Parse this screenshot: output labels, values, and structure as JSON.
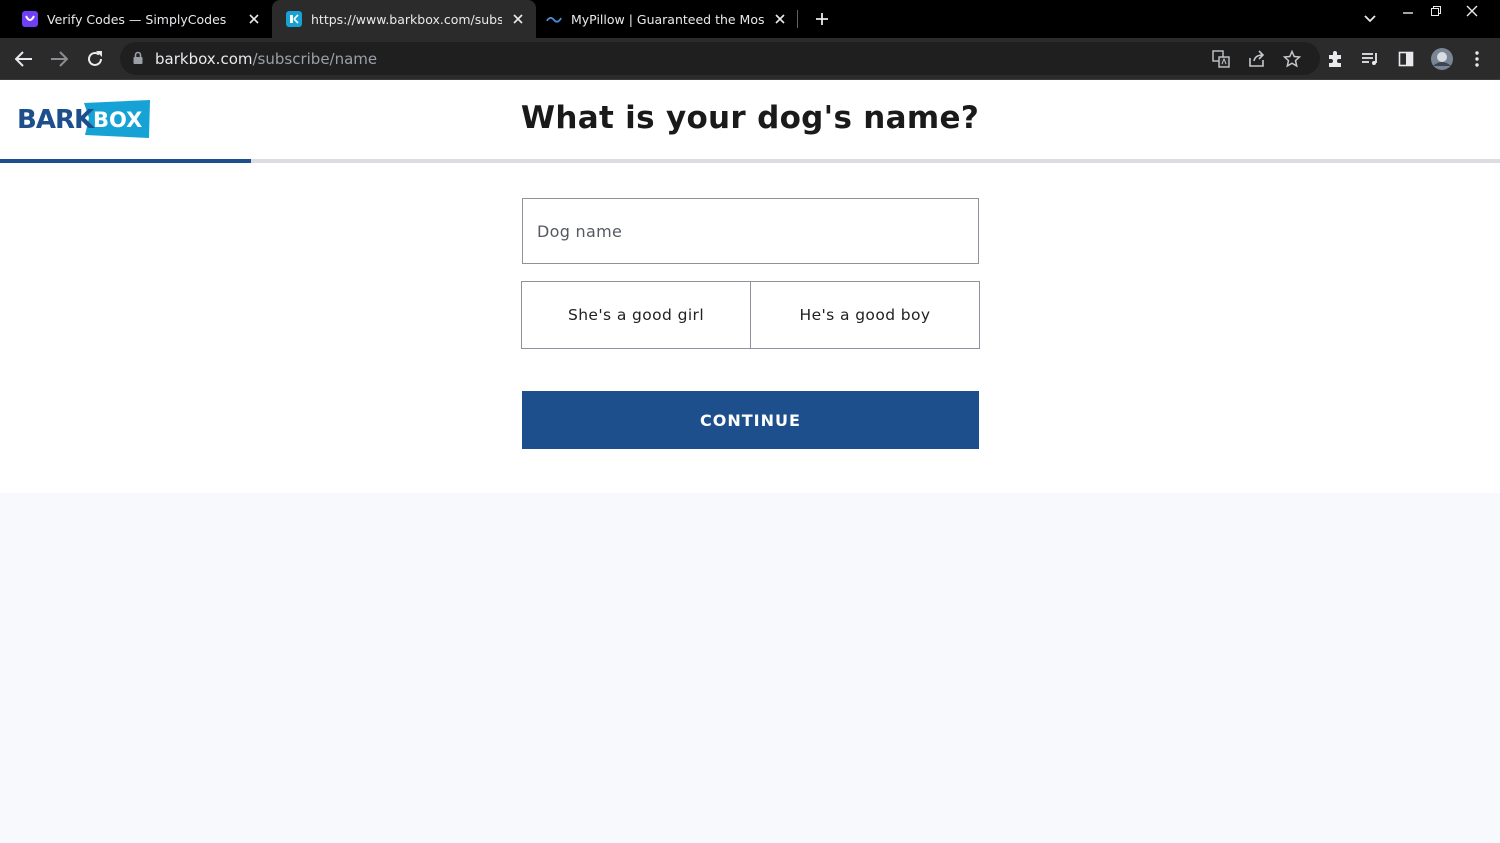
{
  "browser": {
    "tabs": [
      {
        "title": "Verify Codes — SimplyCodes",
        "favicon": "simplycodes-icon",
        "favicon_color": "#6f3ff5",
        "active": false
      },
      {
        "title": "https://www.barkbox.com/subscribe",
        "favicon": "barkbox-icon",
        "favicon_color": "#17a2d6",
        "active": true
      },
      {
        "title": "MyPillow | Guaranteed the Most Comfortable",
        "favicon": "mypillow-icon",
        "favicon_color": "#4a8fd9",
        "active": false
      }
    ],
    "url_host": "barkbox.com",
    "url_path": "/subscribe/name"
  },
  "page": {
    "logo": {
      "text_left": "BARK",
      "text_right": "BOX",
      "color_primary": "#1d4f8c",
      "color_secondary": "#17a2d6"
    },
    "title": "What is your dog's name?",
    "progress": 0.167,
    "form": {
      "dog_name_placeholder": "Dog name",
      "dog_name_value": "",
      "gender_options": [
        "She's a good girl",
        "He's a good boy"
      ],
      "continue_label": "CONTINUE"
    }
  },
  "colors": {
    "accent": "#1c4f8c",
    "progress": "#1d4f8c"
  }
}
